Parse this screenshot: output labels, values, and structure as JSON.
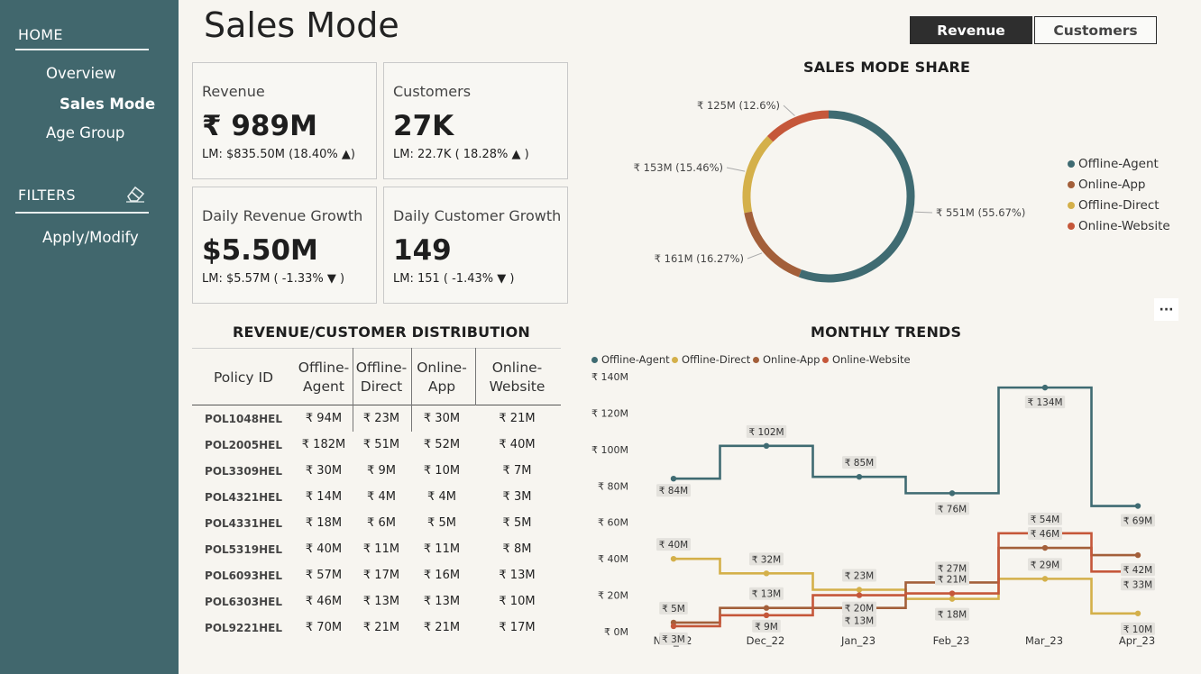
{
  "sidebar": {
    "home": "HOME",
    "nav": [
      "Overview",
      "Sales Mode",
      "Age Group"
    ],
    "filters": "FILTERS",
    "apply": "Apply/Modify",
    "eraser_icon": "eraser-icon"
  },
  "title": "Sales Mode",
  "toggle": {
    "revenue": "Revenue",
    "customers": "Customers"
  },
  "kpis": [
    {
      "label": "Revenue",
      "value": "₹ 989M",
      "sub": "LM: $835.50M (18.40% ▲)"
    },
    {
      "label": "Customers",
      "value": "27K",
      "sub": "LM: 22.7K ( 18.28% ▲ )"
    },
    {
      "label": "Daily Revenue Growth",
      "value": "$5.50M",
      "sub": "LM: $5.57M ( -1.33% ▼ )"
    },
    {
      "label": "Daily Customer Growth",
      "value": "149",
      "sub": "LM: 151 ( -1.43% ▼ )"
    }
  ],
  "table": {
    "title": "REVENUE/CUSTOMER DISTRIBUTION",
    "headers": [
      "Policy ID",
      "Offline-\nAgent",
      "Offline-\nDirect",
      "Online-\nApp",
      "Online-\nWebsite"
    ],
    "rows": [
      [
        "POL1048HEL",
        "₹ 94M",
        "₹ 23M",
        "₹ 30M",
        "₹ 21M"
      ],
      [
        "POL2005HEL",
        "₹ 182M",
        "₹ 51M",
        "₹ 52M",
        "₹ 40M"
      ],
      [
        "POL3309HEL",
        "₹ 30M",
        "₹ 9M",
        "₹ 10M",
        "₹ 7M"
      ],
      [
        "POL4321HEL",
        "₹ 14M",
        "₹ 4M",
        "₹ 4M",
        "₹ 3M"
      ],
      [
        "POL4331HEL",
        "₹ 18M",
        "₹ 6M",
        "₹ 5M",
        "₹ 5M"
      ],
      [
        "POL5319HEL",
        "₹ 40M",
        "₹ 11M",
        "₹ 11M",
        "₹ 8M"
      ],
      [
        "POL6093HEL",
        "₹ 57M",
        "₹ 17M",
        "₹ 16M",
        "₹ 13M"
      ],
      [
        "POL6303HEL",
        "₹ 46M",
        "₹ 13M",
        "₹ 13M",
        "₹ 10M"
      ],
      [
        "POL9221HEL",
        "₹ 70M",
        "₹ 21M",
        "₹ 21M",
        "₹ 17M"
      ]
    ]
  },
  "colors": {
    "Offline-Agent": "#3f6b72",
    "Online-App": "#a35f3a",
    "Offline-Direct": "#d4b04a",
    "Online-Website": "#c5573a"
  },
  "more_icon": "more-options-icon",
  "chart_data": [
    {
      "type": "pie",
      "title": "SALES MODE SHARE",
      "legend": [
        "Offline-Agent",
        "Online-App",
        "Offline-Direct",
        "Online-Website"
      ],
      "slices": [
        {
          "name": "Offline-Agent",
          "value": 551,
          "label": "₹ 551M (55.67%)"
        },
        {
          "name": "Online-App",
          "value": 161,
          "label": "₹ 161M (16.27%)"
        },
        {
          "name": "Offline-Direct",
          "value": 153,
          "label": "₹ 153M (15.46%)"
        },
        {
          "name": "Online-Website",
          "value": 125,
          "label": "₹ 125M (12.6%)"
        }
      ],
      "legend_position": "right"
    },
    {
      "type": "line",
      "title": "MONTHLY TRENDS",
      "categories": [
        "Nov_22",
        "Dec_22",
        "Jan_23",
        "Feb_23",
        "Mar_23",
        "Apr_23"
      ],
      "y_ticks": [
        "₹ 0M",
        "₹ 20M",
        "₹ 40M",
        "₹ 60M",
        "₹ 80M",
        "₹ 100M",
        "₹ 120M",
        "₹ 140M"
      ],
      "ylim": [
        0,
        140
      ],
      "legend_position": "top-left",
      "series": [
        {
          "name": "Offline-Agent",
          "values": [
            84,
            102,
            85,
            76,
            134,
            69
          ],
          "labels": [
            "₹ 84M",
            "₹ 102M",
            "₹ 85M",
            "₹ 76M",
            "₹ 134M",
            "₹ 69M"
          ]
        },
        {
          "name": "Offline-Direct",
          "values": [
            40,
            32,
            23,
            18,
            29,
            10
          ],
          "labels": [
            "₹ 40M",
            "₹ 32M",
            "₹ 23M",
            "₹ 18M",
            "₹ 29M",
            "₹ 10M"
          ]
        },
        {
          "name": "Online-App",
          "values": [
            5,
            13,
            13,
            27,
            46,
            42
          ],
          "labels": [
            "₹ 5M",
            "₹ 13M",
            "₹ 13M",
            "₹ 27M",
            "₹ 46M",
            "₹ 42M"
          ]
        },
        {
          "name": "Online-Website",
          "values": [
            3,
            9,
            20,
            21,
            54,
            33
          ],
          "labels": [
            "₹ 3M",
            "₹ 9M",
            "₹ 20M",
            "₹ 21M",
            "₹ 54M",
            "₹ 33M"
          ]
        }
      ]
    }
  ]
}
